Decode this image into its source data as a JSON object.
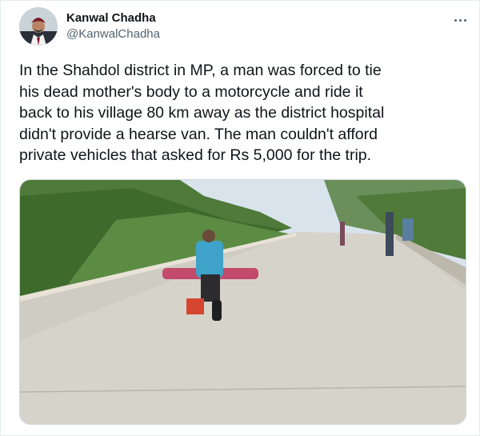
{
  "author": {
    "name": "Kanwal Chadha",
    "handle": "@KanwalChadha"
  },
  "tweet": {
    "text": "In the Shahdol district in MP, a man was forced to tie\nhis dead mother's body to a motorcycle and ride it\nback to his village 80 km away as the district hospital\ndidn't provide a hearse van. The man couldn't afford\nprivate vehicles that asked for Rs 5,000 for the trip."
  },
  "icons": {
    "more": "more-options-icon"
  },
  "colors": {
    "primary_text": "#0f1419",
    "secondary_text": "#536471",
    "border": "#cfd9de"
  }
}
